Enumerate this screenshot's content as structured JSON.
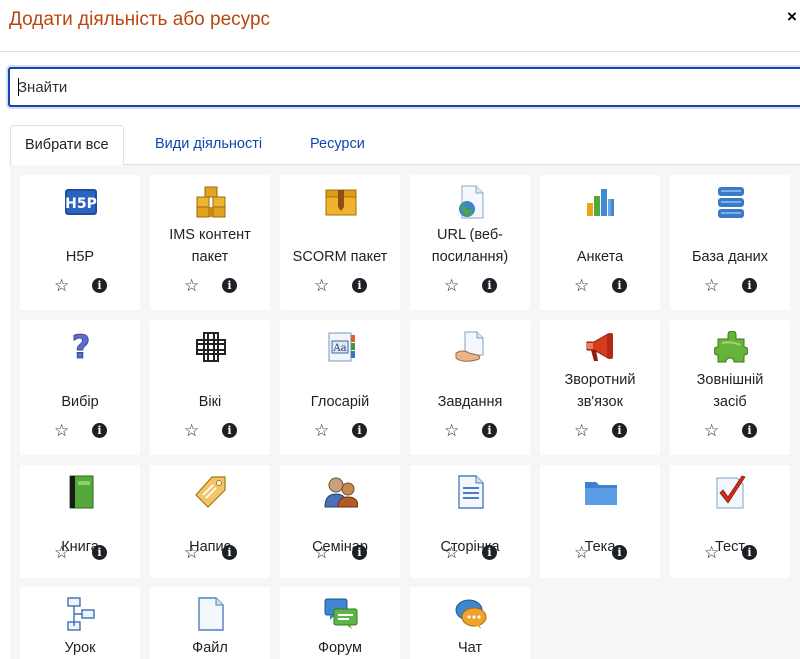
{
  "header": {
    "title": "Додати діяльність або ресурс",
    "close_glyph": "×"
  },
  "search": {
    "placeholder": "Знайти"
  },
  "tabs": [
    {
      "label": "Вибрати все",
      "active": true
    },
    {
      "label": "Види діяльності",
      "active": false
    },
    {
      "label": "Ресурси",
      "active": false
    }
  ],
  "colors": {
    "title": "#b8470f",
    "link": "#0f47ad",
    "focus_border": "#0f47ad",
    "grid_bg": "#f5f6f7"
  },
  "icons": {
    "favourite": "star-outline-icon",
    "info": "info-circle-icon"
  },
  "items": [
    {
      "name_lines": [
        "H5P"
      ],
      "icon": "h5p-icon"
    },
    {
      "name_lines": [
        "IMS контент",
        "пакет"
      ],
      "icon": "ims-package-icon"
    },
    {
      "name_lines": [
        "SCORM пакет"
      ],
      "icon": "scorm-package-icon"
    },
    {
      "name_lines": [
        "URL (веб-",
        "посилання)"
      ],
      "icon": "url-icon"
    },
    {
      "name_lines": [
        "Анкета"
      ],
      "icon": "feedback-chart-icon"
    },
    {
      "name_lines": [
        "База даних"
      ],
      "icon": "database-icon"
    },
    {
      "name_lines": [
        "Вибір"
      ],
      "icon": "question-mark-icon"
    },
    {
      "name_lines": [
        "Вікі"
      ],
      "icon": "wiki-icon"
    },
    {
      "name_lines": [
        "Глосарій"
      ],
      "icon": "glossary-icon"
    },
    {
      "name_lines": [
        "Завдання"
      ],
      "icon": "assignment-icon"
    },
    {
      "name_lines": [
        "Зворотний",
        "зв'язок"
      ],
      "icon": "megaphone-icon"
    },
    {
      "name_lines": [
        "Зовнішній",
        "засіб"
      ],
      "icon": "puzzle-icon"
    },
    {
      "name_lines": [
        "Книга"
      ],
      "icon": "book-icon"
    },
    {
      "name_lines": [
        "Напис"
      ],
      "icon": "label-tag-icon"
    },
    {
      "name_lines": [
        "Семінар"
      ],
      "icon": "workshop-icon"
    },
    {
      "name_lines": [
        "Сторінка"
      ],
      "icon": "page-icon"
    },
    {
      "name_lines": [
        "Тека"
      ],
      "icon": "folder-icon"
    },
    {
      "name_lines": [
        "Тест"
      ],
      "icon": "quiz-icon"
    },
    {
      "name_lines": [
        "Урок"
      ],
      "icon": "lesson-icon"
    },
    {
      "name_lines": [
        "Файл"
      ],
      "icon": "file-icon"
    },
    {
      "name_lines": [
        "Форум"
      ],
      "icon": "forum-icon"
    },
    {
      "name_lines": [
        "Чат"
      ],
      "icon": "chat-icon"
    }
  ]
}
